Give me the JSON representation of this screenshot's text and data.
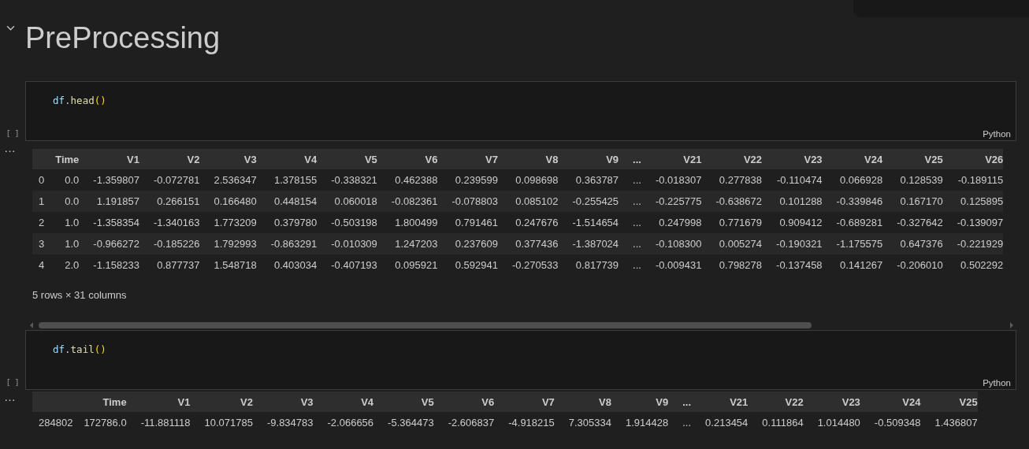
{
  "heading": {
    "text": "PreProcessing",
    "expanded": true
  },
  "cells": [
    {
      "prompt": "[ ]",
      "code": "df.head()",
      "language": "Python",
      "output": {
        "menu": "…",
        "columns": [
          "",
          "Time",
          "V1",
          "V2",
          "V3",
          "V4",
          "V5",
          "V6",
          "V7",
          "V8",
          "V9",
          "...",
          "V21",
          "V22",
          "V23",
          "V24",
          "V25",
          "V26"
        ],
        "rows": [
          [
            "0",
            "0.0",
            "-1.359807",
            "-0.072781",
            "2.536347",
            "1.378155",
            "-0.338321",
            "0.462388",
            "0.239599",
            "0.098698",
            "0.363787",
            "...",
            "-0.018307",
            "0.277838",
            "-0.110474",
            "0.066928",
            "0.128539",
            "-0.189115"
          ],
          [
            "1",
            "0.0",
            "1.191857",
            "0.266151",
            "0.166480",
            "0.448154",
            "0.060018",
            "-0.082361",
            "-0.078803",
            "0.085102",
            "-0.255425",
            "...",
            "-0.225775",
            "-0.638672",
            "0.101288",
            "-0.339846",
            "0.167170",
            "0.125895"
          ],
          [
            "2",
            "1.0",
            "-1.358354",
            "-1.340163",
            "1.773209",
            "0.379780",
            "-0.503198",
            "1.800499",
            "0.791461",
            "0.247676",
            "-1.514654",
            "...",
            "0.247998",
            "0.771679",
            "0.909412",
            "-0.689281",
            "-0.327642",
            "-0.139097"
          ],
          [
            "3",
            "1.0",
            "-0.966272",
            "-0.185226",
            "1.792993",
            "-0.863291",
            "-0.010309",
            "1.247203",
            "0.237609",
            "0.377436",
            "-1.387024",
            "...",
            "-0.108300",
            "0.005274",
            "-0.190321",
            "-1.175575",
            "0.647376",
            "-0.221929"
          ],
          [
            "4",
            "2.0",
            "-1.158233",
            "0.877737",
            "1.548718",
            "0.403034",
            "-0.407193",
            "0.095921",
            "0.592941",
            "-0.270533",
            "0.817739",
            "...",
            "-0.009431",
            "0.798278",
            "-0.137458",
            "0.141267",
            "-0.206010",
            "0.502292"
          ]
        ],
        "summary": "5 rows × 31 columns",
        "scrollbar": true
      }
    },
    {
      "prompt": "[ ]",
      "code": "df.tail()",
      "language": "Python",
      "output": {
        "menu": "…",
        "columns": [
          "",
          "Time",
          "V1",
          "V2",
          "V3",
          "V4",
          "V5",
          "V6",
          "V7",
          "V8",
          "V9",
          "...",
          "V21",
          "V22",
          "V23",
          "V24",
          "V25"
        ],
        "rows": [
          [
            "284802",
            "172786.0",
            "-11.881118",
            "10.071785",
            "-9.834783",
            "-2.066656",
            "-5.364473",
            "-2.606837",
            "-4.918215",
            "7.305334",
            "1.914428",
            "...",
            "0.213454",
            "0.111864",
            "1.014480",
            "-0.509348",
            "1.436807"
          ]
        ]
      }
    }
  ]
}
